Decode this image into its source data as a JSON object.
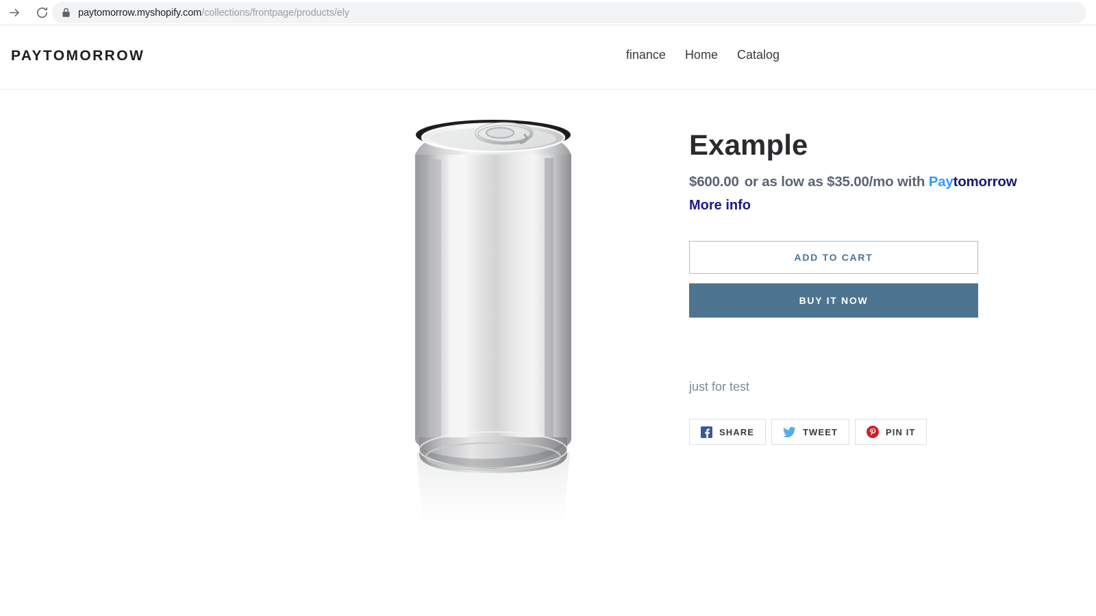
{
  "browser": {
    "forward_icon": "forward-arrow-icon",
    "reload_icon": "reload-icon",
    "lock_icon": "lock-icon",
    "url_domain": "paytomorrow.myshopify.com",
    "url_path": "/collections/frontpage/products/ely",
    "url_full": "paytomorrow.myshopify.com/collections/frontpage/products/ely"
  },
  "site_header": {
    "brand": "PAYTOMORROW",
    "nav": [
      {
        "label": "finance"
      },
      {
        "label": "Home"
      },
      {
        "label": "Catalog"
      }
    ]
  },
  "product": {
    "title": "Example",
    "price": "$600.00",
    "financing_text": "or as low as $35.00/mo with",
    "financing_brand_first": "Pay",
    "financing_brand_second": "tomorrow",
    "more_info_label": "More info",
    "description": "just for test",
    "media_alt": "aluminum-soda-can"
  },
  "actions": {
    "add_to_cart_label": "ADD TO CART",
    "buy_it_now_label": "BUY IT NOW"
  },
  "share": [
    {
      "label": "SHARE",
      "icon": "facebook-icon",
      "color": "#3b5998"
    },
    {
      "label": "TWEET",
      "icon": "twitter-icon",
      "color": "#55acee"
    },
    {
      "label": "PIN IT",
      "icon": "pinterest-icon",
      "color": "#cb2027"
    }
  ],
  "colors": {
    "accent_button": "#4d7491",
    "brand_pay": "#3399ff",
    "brand_tomorrow": "#1a1a6e",
    "more_info": "#1a1a8c",
    "price_text": "#5a6473"
  }
}
